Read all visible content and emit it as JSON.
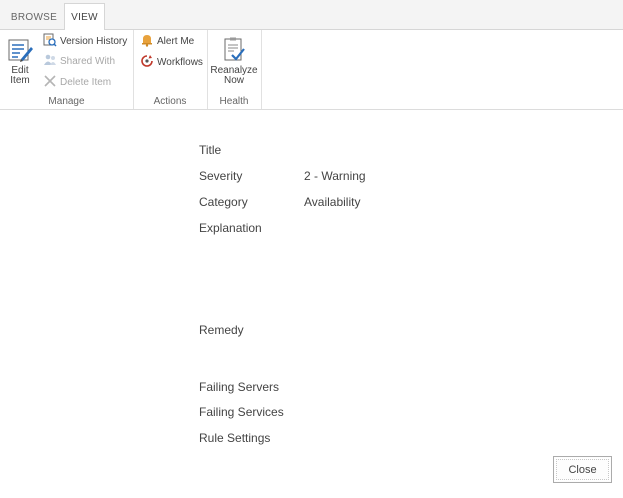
{
  "ribbon": {
    "tabs": [
      {
        "label": "BROWSE",
        "active": false
      },
      {
        "label": "VIEW",
        "active": true
      }
    ],
    "groups": {
      "manage": {
        "label": "Manage",
        "edit_item": {
          "line1": "Edit",
          "line2": "Item",
          "icon": "edit-item-icon"
        },
        "version_history": {
          "label": "Version History",
          "icon": "version-history-icon"
        },
        "shared_with": {
          "label": "Shared With",
          "icon": "shared-with-icon",
          "disabled": true
        },
        "delete_item": {
          "label": "Delete Item",
          "icon": "delete-icon",
          "disabled": true
        }
      },
      "actions": {
        "label": "Actions",
        "alert_me": {
          "label": "Alert Me",
          "icon": "bell-icon"
        },
        "workflows": {
          "label": "Workflows",
          "icon": "workflows-icon"
        }
      },
      "health": {
        "label": "Health",
        "reanalyze": {
          "line1": "Reanalyze",
          "line2": "Now",
          "icon": "reanalyze-icon"
        }
      }
    }
  },
  "form": {
    "fields": [
      {
        "label": "Title",
        "value": ""
      },
      {
        "label": "Severity",
        "value": "2 - Warning"
      },
      {
        "label": "Category",
        "value": "Availability"
      },
      {
        "label": "Explanation",
        "value": ""
      },
      {
        "label": "Remedy",
        "value": ""
      },
      {
        "label": "Failing Servers",
        "value": ""
      },
      {
        "label": "Failing Services",
        "value": ""
      },
      {
        "label": "Rule Settings",
        "value": ""
      }
    ],
    "close_button": "Close"
  },
  "colors": {
    "tab_bar_bg": "#f4f4f4",
    "text": "#444444",
    "disabled_text": "#a8a8a8",
    "icon_blue": "#2a6ebb",
    "bell_orange": "#e8a23c"
  }
}
